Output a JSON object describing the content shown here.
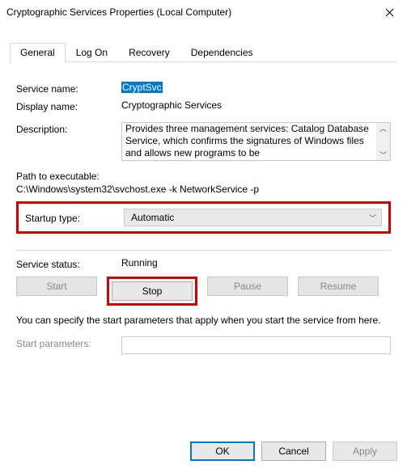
{
  "window": {
    "title": "Cryptographic Services Properties (Local Computer)"
  },
  "tabs": {
    "general": "General",
    "logon": "Log On",
    "recovery": "Recovery",
    "dependencies": "Dependencies"
  },
  "labels": {
    "service_name": "Service name:",
    "display_name": "Display name:",
    "description": "Description:",
    "path_to_exec": "Path to executable:",
    "startup_type": "Startup type:",
    "service_status": "Service status:",
    "start_parameters": "Start parameters:"
  },
  "values": {
    "service_name": "CryptSvc",
    "display_name": "Cryptographic Services",
    "description": "Provides three management services: Catalog Database Service, which confirms the signatures of Windows files and allows new programs to be",
    "path": "C:\\Windows\\system32\\svchost.exe -k NetworkService -p",
    "startup_type": "Automatic",
    "service_status": "Running",
    "start_parameters": ""
  },
  "buttons": {
    "start": "Start",
    "stop": "Stop",
    "pause": "Pause",
    "resume": "Resume",
    "ok": "OK",
    "cancel": "Cancel",
    "apply": "Apply"
  },
  "note": "You can specify the start parameters that apply when you start the service from here."
}
